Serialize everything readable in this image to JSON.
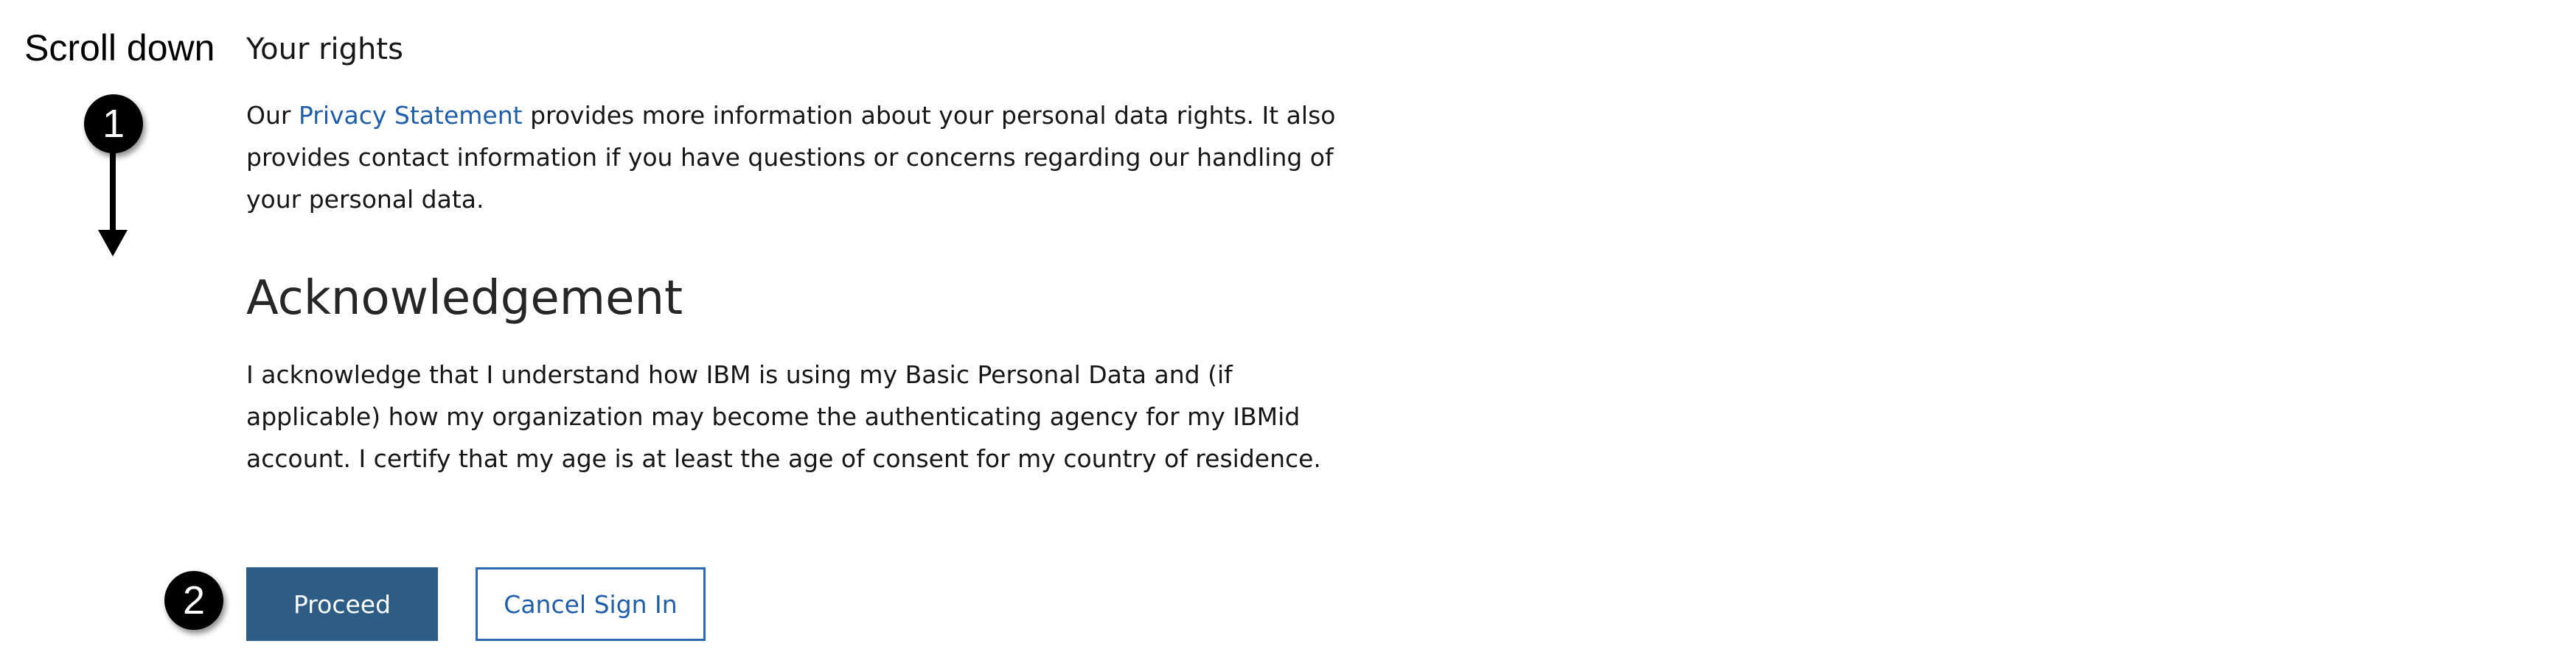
{
  "annotations": {
    "scroll_label": "Scroll down",
    "step_1": "1",
    "step_2": "2"
  },
  "rights": {
    "title": "Your rights",
    "text_before_link": "Our ",
    "link_text": "Privacy Statement",
    "text_after_link": " provides more information about your personal data rights. It also provides contact information if you have questions or concerns regarding our handling of your personal data."
  },
  "acknowledgement": {
    "heading": "Acknowledgement",
    "text": "I acknowledge that I understand how IBM is using my Basic Personal Data and (if applicable) how my organization may become the authenticating agency for my IBMid account. I certify that my age is at least the age of consent for my country of residence."
  },
  "actions": {
    "proceed_label": "Proceed",
    "cancel_label": "Cancel Sign In"
  },
  "colors": {
    "primary_button": "#2d5d85",
    "link": "#1f5ea8",
    "annotation": "#000000"
  }
}
